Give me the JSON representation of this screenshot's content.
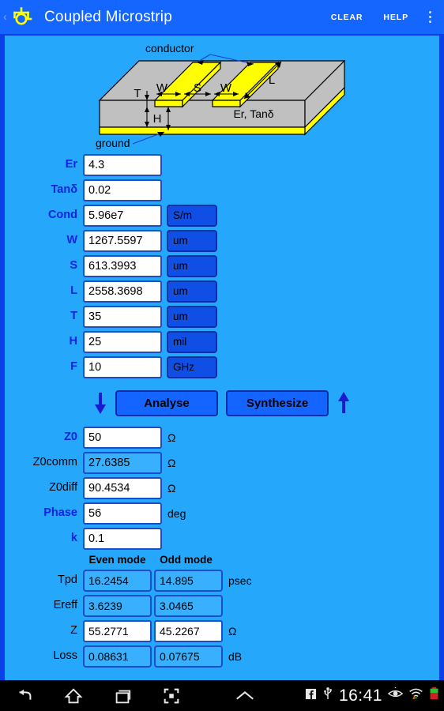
{
  "actionbar": {
    "back_glyph": "‹",
    "logo_icon": "app-logo-icon",
    "title": "Coupled Microstrip",
    "clear_label": "CLEAR",
    "help_label": "HELP",
    "overflow_icon": "overflow-menu-icon"
  },
  "diagram": {
    "name": "coupled-microstrip-3d-diagram",
    "labels": {
      "conductor": "conductor",
      "ground": "ground",
      "T": "T",
      "W1": "W",
      "S": "S",
      "W2": "W",
      "L": "L",
      "H": "H",
      "material": "Εr, Tanδ"
    },
    "colors": {
      "substrate": "#c0c0c0",
      "metal": "#ffff00",
      "background": "#25a7fc"
    }
  },
  "inputs": [
    {
      "label": "Εr",
      "value": "4.3",
      "unit": null,
      "editable": true
    },
    {
      "label": "Tanδ",
      "value": "0.02",
      "unit": null,
      "editable": true
    },
    {
      "label": "Cond",
      "value": "5.96e7",
      "unit": "S/m",
      "editable": true
    },
    {
      "label": "W",
      "value": "1267.5597",
      "unit": "um",
      "editable": true
    },
    {
      "label": "S",
      "value": "613.3993",
      "unit": "um",
      "editable": true
    },
    {
      "label": "L",
      "value": "2558.3698",
      "unit": "um",
      "editable": true
    },
    {
      "label": "T",
      "value": "35",
      "unit": "um",
      "editable": true
    },
    {
      "label": "H",
      "value": "25",
      "unit": "mil",
      "editable": true
    },
    {
      "label": "F",
      "value": "10",
      "unit": "GHz",
      "editable": true
    }
  ],
  "actions": {
    "down_arrow_icon": "arrow-down-icon",
    "analyse_label": "Analyse",
    "synthesize_label": "Synthesize",
    "up_arrow_icon": "arrow-up-icon"
  },
  "outputs": [
    {
      "label": "Z0",
      "value": "50",
      "unit": "Ω",
      "readonly": false,
      "label_blue": true
    },
    {
      "label": "Z0comm",
      "value": "27.6385",
      "unit": "Ω",
      "readonly": true,
      "label_blue": false
    },
    {
      "label": "Z0diff",
      "value": "90.4534",
      "unit": "Ω",
      "readonly": false,
      "label_blue": false
    },
    {
      "label": "Phase",
      "value": "56",
      "unit": "deg",
      "readonly": false,
      "label_blue": true
    },
    {
      "label": "k",
      "value": "0.1",
      "unit": "",
      "readonly": false,
      "label_blue": true
    }
  ],
  "modes": {
    "even_header": "Even mode",
    "odd_header": "Odd mode",
    "rows": [
      {
        "label": "Tpd",
        "even": "16.2454",
        "odd": "14.895",
        "unit": "psec",
        "editable": false
      },
      {
        "label": "Εreff",
        "even": "3.6239",
        "odd": "3.0465",
        "unit": "",
        "editable": false
      },
      {
        "label": "Z",
        "even": "55.2771",
        "odd": "45.2267",
        "unit": "Ω",
        "editable": true
      },
      {
        "label": "Loss",
        "even": "0.08631",
        "odd": "0.07675",
        "unit": "dB",
        "editable": false
      }
    ]
  },
  "navbar": {
    "back_icon": "nav-back-icon",
    "home_icon": "nav-home-icon",
    "recents_icon": "nav-recents-icon",
    "screenshot_icon": "nav-screenshot-icon",
    "expand_icon": "nav-expand-icon",
    "facebook_icon": "facebook-notification-icon",
    "usb_icon": "usb-icon",
    "clock": "16:41",
    "eye_icon": "eye-icon",
    "wifi_icon": "wifi-icon",
    "battery_icon": "battery-icon"
  },
  "colors": {
    "accent_blue": "#1565ff",
    "page_blue": "#25a7fc",
    "border_blue": "#0b3fe8",
    "field_readonly": "#39b0fd",
    "label_blue": "#0c23e0",
    "metal_yellow": "#ffff00"
  }
}
